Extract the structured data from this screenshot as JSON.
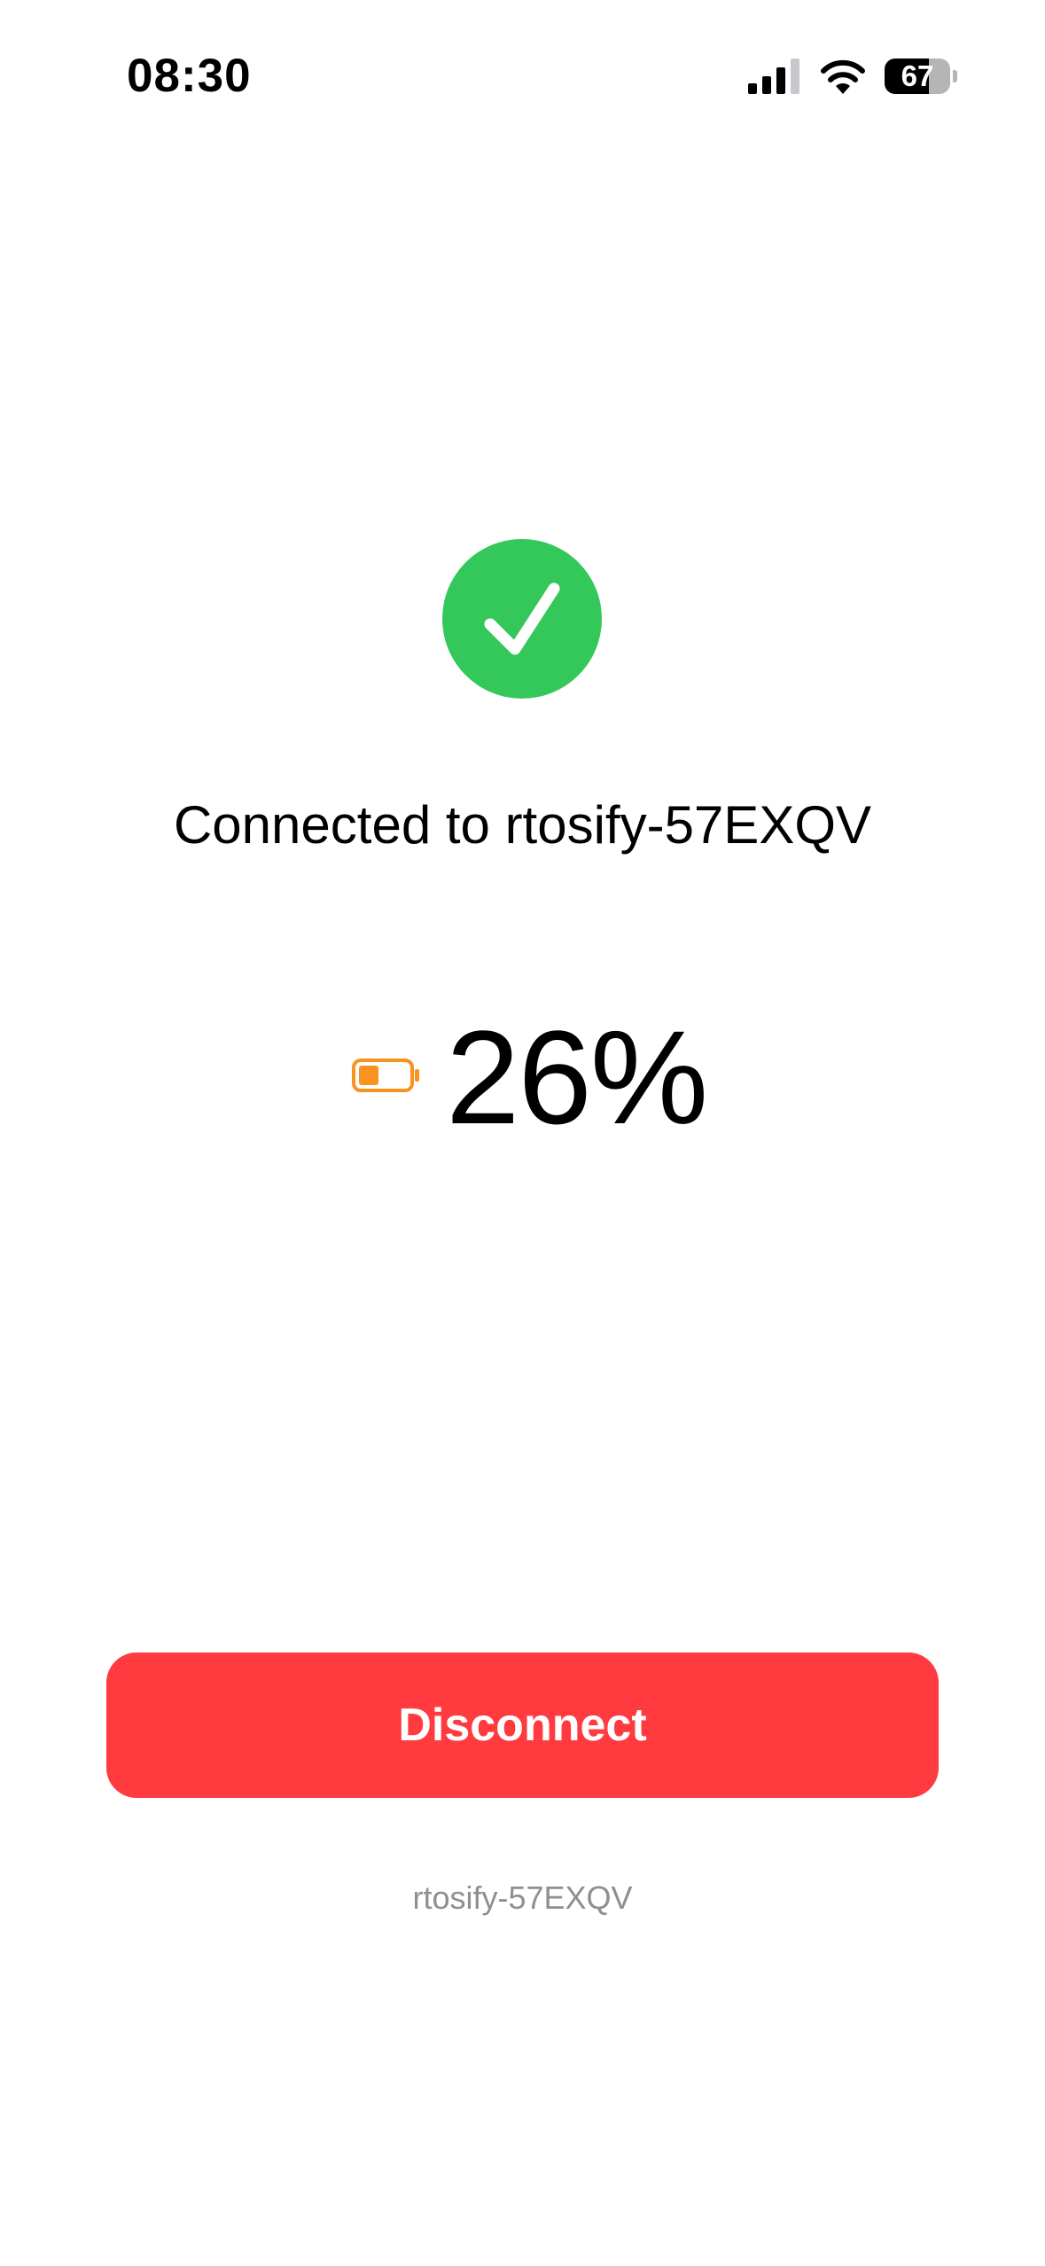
{
  "status_bar": {
    "time": "08:30",
    "battery_level": "67",
    "battery_fraction": 0.67,
    "icons": [
      "signal-icon",
      "wifi-icon",
      "battery-icon"
    ]
  },
  "connection": {
    "status_icon": "checkmark-circle-icon",
    "status_color": "#34c759",
    "title": "Connected to rtosify-57EXQV",
    "device_name": "rtosify-57EXQV"
  },
  "device_battery": {
    "icon": "battery-low-icon",
    "icon_color": "#f7931e",
    "percent_text": "26%",
    "fraction": 0.26
  },
  "actions": {
    "disconnect_label": "Disconnect",
    "disconnect_color": "#ff3b40"
  }
}
